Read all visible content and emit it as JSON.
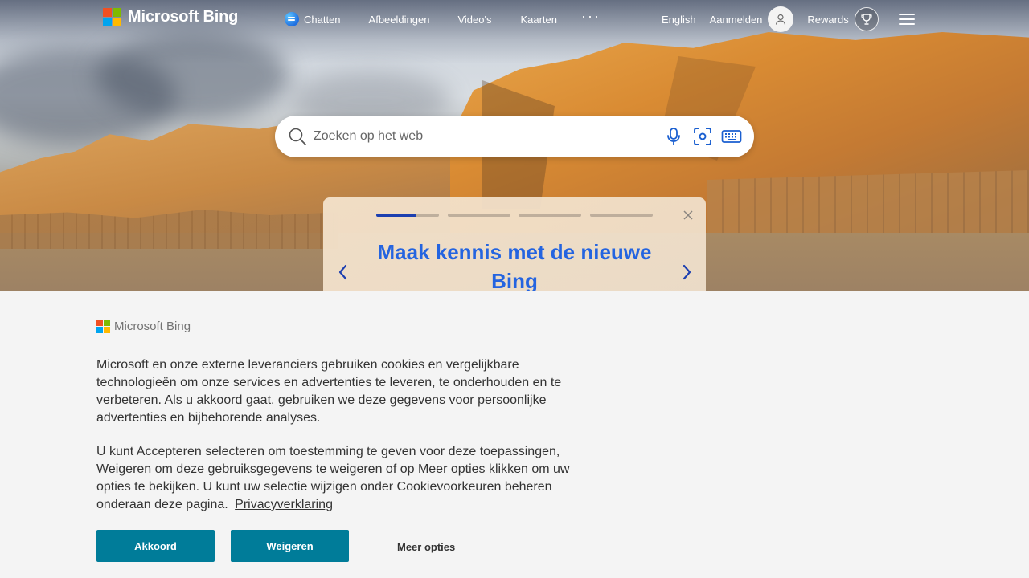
{
  "brand": {
    "name": "Microsoft Bing",
    "logo_colors": [
      "#f25022",
      "#7fba00",
      "#00a4ef",
      "#ffb900"
    ]
  },
  "nav": {
    "items": [
      {
        "label": "Chatten",
        "icon": "copilot-chat-icon"
      },
      {
        "label": "Afbeeldingen"
      },
      {
        "label": "Video's"
      },
      {
        "label": "Kaarten"
      }
    ],
    "more_label": "···"
  },
  "header_right": {
    "language": "English",
    "signin": "Aanmelden",
    "rewards": "Rewards",
    "avatar_icon": "user-icon",
    "rewards_icon": "trophy-icon",
    "menu_icon": "hamburger-icon"
  },
  "search": {
    "placeholder": "Zoeken op het web",
    "icons": [
      "search-icon",
      "microphone-icon",
      "visual-search-icon",
      "keyboard-icon"
    ]
  },
  "carousel": {
    "title": "Maak kennis met de nieuwe Bing",
    "slides": 4,
    "active_slide": 1,
    "active_progress": 0.64,
    "accent_color": "#2464e0"
  },
  "consent": {
    "logo_text": "Microsoft Bing",
    "paragraph1": "Microsoft en onze externe leveranciers gebruiken cookies en vergelijkbare technologieën om onze services en advertenties te leveren, te onderhouden en te verbeteren. Als u akkoord gaat, gebruiken we deze gegevens voor persoonlijke advertenties en bijbehorende analyses.",
    "paragraph2": "U kunt Accepteren selecteren om toestemming te geven voor deze toepassingen, Weigeren om deze gebruiksgegevens te weigeren of op Meer opties klikken om uw opties te bekijken. U kunt uw selectie wijzigen onder Cookievoorkeuren beheren onderaan deze pagina.",
    "privacy_link": "Privacyverklaring",
    "accept_label": "Akkoord",
    "reject_label": "Weigeren",
    "more_label": "Meer opties",
    "button_color": "#007c99"
  }
}
